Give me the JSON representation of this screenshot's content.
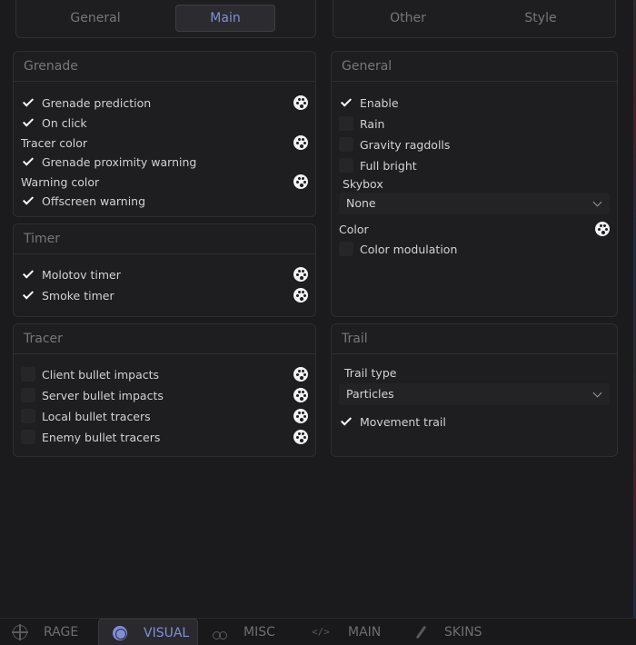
{
  "top_tabs_left": [
    {
      "label": "General",
      "active": false
    },
    {
      "label": "Main",
      "active": true
    }
  ],
  "top_tabs_right": [
    {
      "label": "Other",
      "active": false
    },
    {
      "label": "Style",
      "active": false
    }
  ],
  "grenade": {
    "title": "Grenade",
    "items": [
      {
        "label": "Grenade prediction",
        "checked": true,
        "palette": true
      },
      {
        "label": "On click",
        "checked": true,
        "palette": false
      },
      {
        "label": "Tracer color",
        "checkbox": false,
        "palette": true
      },
      {
        "label": "Grenade proximity warning",
        "checked": true,
        "palette": false
      },
      {
        "label": "Warning color",
        "checkbox": false,
        "palette": true
      },
      {
        "label": "Offscreen warning",
        "checked": true,
        "palette": false
      }
    ]
  },
  "timer": {
    "title": "Timer",
    "items": [
      {
        "label": "Molotov timer",
        "checked": true,
        "palette": true
      },
      {
        "label": "Smoke timer",
        "checked": true,
        "palette": true
      }
    ]
  },
  "tracer": {
    "title": "Tracer",
    "items": [
      {
        "label": "Client bullet impacts",
        "checked": false,
        "palette": true
      },
      {
        "label": "Server bullet impacts",
        "checked": false,
        "palette": true
      },
      {
        "label": "Local bullet tracers",
        "checked": false,
        "palette": true
      },
      {
        "label": "Enemy bullet tracers",
        "checked": false,
        "palette": true
      }
    ]
  },
  "general": {
    "title": "General",
    "items": [
      {
        "label": "Enable",
        "checked": true
      },
      {
        "label": "Rain",
        "checked": false
      },
      {
        "label": "Gravity ragdolls",
        "checked": false
      },
      {
        "label": "Full bright",
        "checked": false
      }
    ],
    "skybox_label": "Skybox",
    "skybox_value": "None",
    "color_label": "Color",
    "color_modulation_label": "Color modulation",
    "color_modulation_checked": false
  },
  "trail": {
    "title": "Trail",
    "trail_type_label": "Trail type",
    "trail_type_value": "Particles",
    "movement_trail_label": "Movement trail",
    "movement_trail_checked": true
  },
  "bottom_tabs": [
    {
      "label": "RAGE",
      "icon": "crosshair-icon",
      "active": false
    },
    {
      "label": "VISUAL",
      "icon": "visual-ball-icon",
      "active": true
    },
    {
      "label": "MISC",
      "icon": "bike-icon",
      "active": false
    },
    {
      "label": "MAIN",
      "icon": "code-icon",
      "active": false
    },
    {
      "label": "SKINS",
      "icon": "knife-icon",
      "active": false
    }
  ],
  "colors": {
    "accent": "#7e8fd8",
    "background": "#1b1b1d",
    "panel": "#1e1e20"
  }
}
